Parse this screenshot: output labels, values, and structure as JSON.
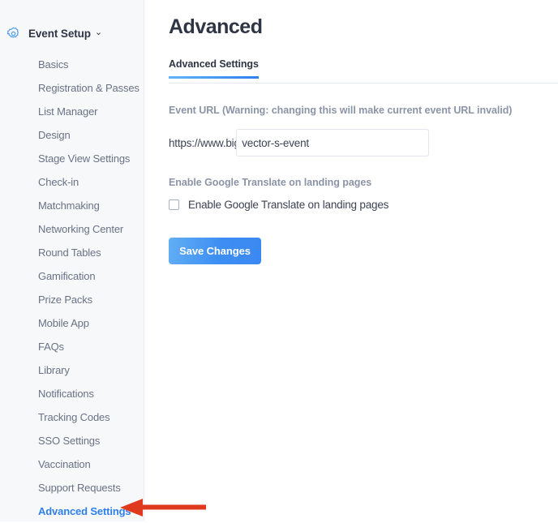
{
  "sidebar": {
    "header": {
      "icon": "gear-icon",
      "label": "Event Setup",
      "chevron": "chevron-down-icon",
      "chevron_glyph": "⌄"
    },
    "items": [
      {
        "label": "Basics",
        "active": false
      },
      {
        "label": "Registration & Passes",
        "active": false
      },
      {
        "label": "List Manager",
        "active": false
      },
      {
        "label": "Design",
        "active": false
      },
      {
        "label": "Stage View Settings",
        "active": false
      },
      {
        "label": "Check-in",
        "active": false
      },
      {
        "label": "Matchmaking",
        "active": false
      },
      {
        "label": "Networking Center",
        "active": false
      },
      {
        "label": "Round Tables",
        "active": false
      },
      {
        "label": "Gamification",
        "active": false
      },
      {
        "label": "Prize Packs",
        "active": false
      },
      {
        "label": "Mobile App",
        "active": false
      },
      {
        "label": "FAQs",
        "active": false
      },
      {
        "label": "Library",
        "active": false
      },
      {
        "label": "Notifications",
        "active": false
      },
      {
        "label": "Tracking Codes",
        "active": false
      },
      {
        "label": "SSO Settings",
        "active": false
      },
      {
        "label": "Vaccination",
        "active": false
      },
      {
        "label": "Support Requests",
        "active": false
      },
      {
        "label": "Advanced Settings",
        "active": true
      }
    ]
  },
  "main": {
    "page_title": "Advanced",
    "tabs": [
      {
        "label": "Advanced Settings",
        "active": true
      }
    ],
    "event_url": {
      "section_label": "Event URL (Warning: changing this will make current event URL invalid)",
      "prefix": "https://www.bigmarker.com/series/",
      "value": "vector-s-event",
      "placeholder": ""
    },
    "google_translate": {
      "section_label": "Enable Google Translate on landing pages",
      "checkbox_label": "Enable Google Translate on landing pages",
      "checked": false
    },
    "save_button": {
      "label": "Save Changes"
    }
  },
  "annotation": {
    "arrow": "left-arrow-annotation",
    "color": "#e03a1e"
  },
  "colors": {
    "accent": "#2f80ed",
    "button_start": "#62aef4",
    "button_end": "#3b88f2",
    "sidebar_bg": "#f7f8fa",
    "text_dark": "#2f3545",
    "text_muted": "#697285",
    "label_muted": "#8b94a7",
    "annotation_red": "#e03a1e"
  }
}
